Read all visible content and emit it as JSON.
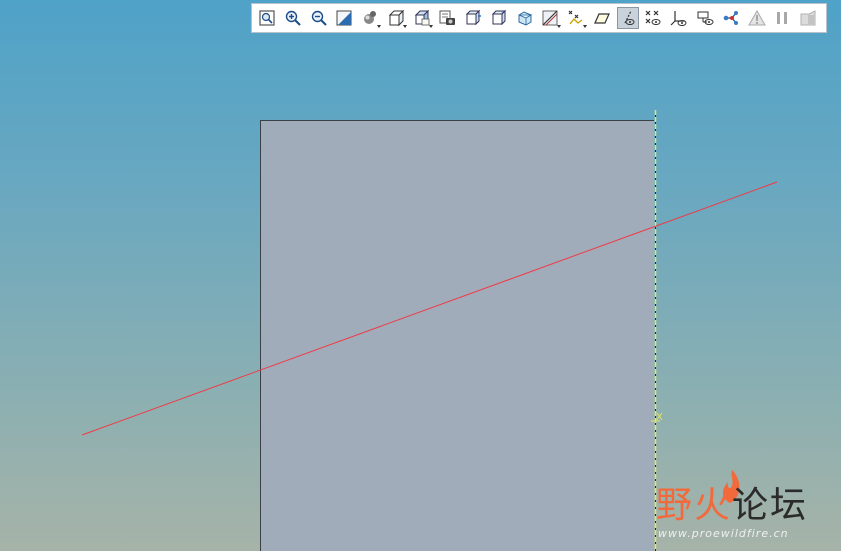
{
  "toolbar": {
    "buttons": [
      {
        "name": "refit-icon"
      },
      {
        "name": "zoom-in-icon"
      },
      {
        "name": "zoom-out-icon"
      },
      {
        "name": "repaint-icon"
      },
      {
        "name": "display-style-icon",
        "dropdown": true
      },
      {
        "name": "saved-views-icon",
        "dropdown": true
      },
      {
        "name": "view-manager-icon",
        "dropdown": true
      },
      {
        "name": "appearance-gallery-icon"
      },
      {
        "name": "perspective-icon"
      },
      {
        "name": "section-icon"
      },
      {
        "name": "orient-view-icon"
      },
      {
        "name": "sketch-view-icon",
        "dropdown": true
      },
      {
        "name": "datum-display-icon",
        "dropdown": true
      },
      {
        "name": "datum-plane-icon"
      },
      {
        "name": "datum-axis-display-icon",
        "active": true
      },
      {
        "name": "datum-point-display-icon"
      },
      {
        "name": "csys-display-icon"
      },
      {
        "name": "annotation-display-icon"
      },
      {
        "name": "spin-center-icon"
      },
      {
        "name": "warning-icon"
      },
      {
        "name": "pause-icon"
      },
      {
        "name": "regenerate-icon"
      }
    ]
  },
  "scene": {
    "axis_label": "X"
  },
  "watermark": {
    "text_orange": "野火",
    "text_dark": "论坛",
    "url": "www.proewildfire.cn"
  },
  "colors": {
    "sketch_line": "#ee3b46",
    "axis_line": "#e8e85a",
    "part_face": "#a1acbb",
    "toolbar_bg": "#ffffff"
  }
}
